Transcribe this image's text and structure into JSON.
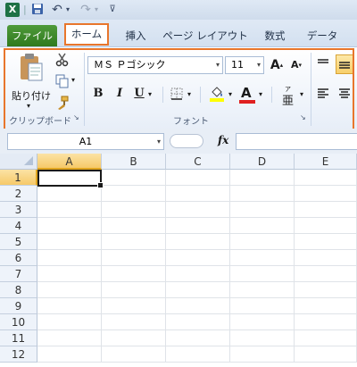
{
  "qat": {
    "excel_logo": "X",
    "undo_glyph": "↶",
    "redo_glyph": "↷",
    "dropdown_glyph": "▾",
    "customize_glyph": "⊽"
  },
  "tabs": [
    {
      "label": "ファイル"
    },
    {
      "label": "ホーム"
    },
    {
      "label": "挿入"
    },
    {
      "label": "ページ レイアウト"
    },
    {
      "label": "数式"
    },
    {
      "label": "データ"
    }
  ],
  "clipboard": {
    "group_label": "クリップボード",
    "paste_label": "貼り付け"
  },
  "font": {
    "group_label": "フォント",
    "font_name": "ＭＳ Ｐゴシック",
    "font_size": "11",
    "grow_label": "A",
    "shrink_label": "A",
    "bold_label": "B",
    "italic_label": "I",
    "underline_label": "U",
    "font_color_label": "A",
    "phonetic_label": "亜"
  },
  "formula_bar": {
    "name_box": "A1",
    "fx_label": "fx",
    "formula": ""
  },
  "grid": {
    "columns": [
      "A",
      "B",
      "C",
      "D",
      "E"
    ],
    "rows": [
      "1",
      "2",
      "3",
      "4",
      "5",
      "6",
      "7",
      "8",
      "9",
      "10",
      "11",
      "12"
    ],
    "selected_cell": "A1"
  },
  "colors": {
    "accent": "#e8762c",
    "file_tab": "#2f7a1e",
    "selection": "#f6c969"
  }
}
